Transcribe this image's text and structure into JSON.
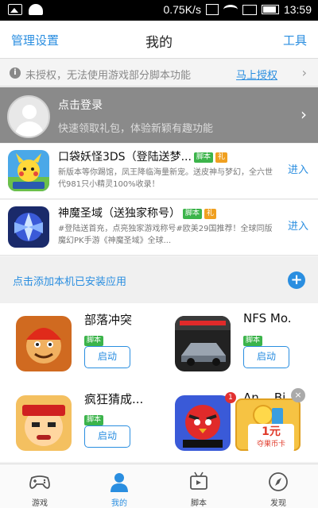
{
  "status_bar": {
    "speed": "0.75K/s",
    "time": "13:59"
  },
  "header": {
    "left": "管理设置",
    "title": "我的",
    "right": "工具"
  },
  "notice": {
    "text": "未授权，无法使用游戏部分脚本功能",
    "link": "马上授权",
    "chevron": "›"
  },
  "login": {
    "title": "点击登录",
    "subtitle": "快速领取礼包，体验新颖有趣功能",
    "chevron": "›"
  },
  "games": [
    {
      "title": "口袋妖怪3DS（登陆送梦...",
      "tags": [
        "脚本",
        "礼"
      ],
      "desc": "新版本等你踢馆，凤王降临海量新宠。送皮神与梦幻，全六世代981只小精灵100%收录！",
      "enter": "进入",
      "icon_name": "pokemon-game-icon"
    },
    {
      "title": "神魔圣域（送独家称号）",
      "tags": [
        "脚本",
        "礼"
      ],
      "desc": "#登陆送首充，点亮独家游戏称号#欧美29国推荐！全球同版魔幻PK手游《神魔圣域》全球...",
      "enter": "进入",
      "icon_name": "shenmo-game-icon"
    }
  ],
  "add_installed": {
    "text": "点击添加本机已安装应用",
    "plus": "+"
  },
  "installed_apps": [
    {
      "name": "部落冲突",
      "tag": "脚本",
      "button": "启动",
      "icon_name": "clash-of-clans-icon"
    },
    {
      "name": "NFS Mo.",
      "tag": "脚本",
      "button": "启动",
      "icon_name": "nfs-most-wanted-icon"
    },
    {
      "name": "疯狂猜成...",
      "tag": "脚本",
      "button": "启动",
      "icon_name": "idiom-quiz-icon"
    },
    {
      "name": "An... Bi.",
      "tag": "",
      "button": "",
      "icon_name": "angry-birds-star-wars-icon",
      "badge": "1"
    }
  ],
  "promo": {
    "amount": "1元",
    "label": "夺果币卡",
    "close": "×"
  },
  "bottom_nav": [
    {
      "label": "游戏",
      "icon_name": "gamepad-icon",
      "active": false
    },
    {
      "label": "我的",
      "icon_name": "user-icon",
      "active": true
    },
    {
      "label": "脚本",
      "icon_name": "script-robot-icon",
      "active": false
    },
    {
      "label": "发现",
      "icon_name": "compass-icon",
      "active": false
    }
  ],
  "colors": {
    "accent": "#2a8ee0",
    "tag_green": "#3cb44b",
    "tag_orange": "#f0a020",
    "login_bg": "#8a8a8a"
  }
}
